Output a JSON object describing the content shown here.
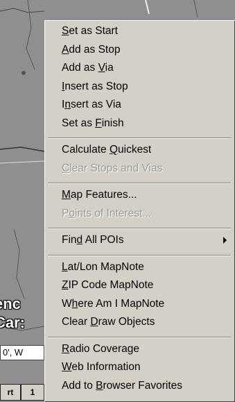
{
  "map": {
    "place_label_line1": "enc",
    "place_label_line2": "Car:",
    "coord_field_value": "0', W",
    "status_buttons": [
      "rt",
      "1"
    ]
  },
  "menu": {
    "groups": [
      [
        {
          "pre": "",
          "key": "S",
          "post": "et as Start",
          "enabled": true
        },
        {
          "pre": "",
          "key": "A",
          "post": "dd as Stop",
          "enabled": true
        },
        {
          "pre": "Add as ",
          "key": "V",
          "post": "ia",
          "enabled": true
        },
        {
          "pre": "",
          "key": "I",
          "post": "nsert as Stop",
          "enabled": true
        },
        {
          "pre": "I",
          "key": "n",
          "post": "sert as Via",
          "enabled": true
        },
        {
          "pre": "Set as ",
          "key": "F",
          "post": "inish",
          "enabled": true
        }
      ],
      [
        {
          "pre": "Calculate ",
          "key": "Q",
          "post": "uickest",
          "enabled": true
        },
        {
          "pre": "",
          "key": "C",
          "post": "lear Stops and Vias",
          "enabled": false
        }
      ],
      [
        {
          "pre": "",
          "key": "M",
          "post": "ap Features...",
          "enabled": true
        },
        {
          "pre": "P",
          "key": "o",
          "post": "ints of Interest...",
          "enabled": false
        }
      ],
      [
        {
          "pre": "Fin",
          "key": "d",
          "post": " All POIs",
          "enabled": true,
          "submenu": true
        }
      ],
      [
        {
          "pre": "",
          "key": "L",
          "post": "at/Lon MapNote",
          "enabled": true
        },
        {
          "pre": "",
          "key": "Z",
          "post": "IP Code MapNote",
          "enabled": true
        },
        {
          "pre": "W",
          "key": "h",
          "post": "ere Am I MapNote",
          "enabled": true
        },
        {
          "pre": "Clear ",
          "key": "D",
          "post": "raw Objects",
          "enabled": true
        }
      ],
      [
        {
          "pre": "",
          "key": "R",
          "post": "adio Coverage",
          "enabled": true
        },
        {
          "pre": "",
          "key": "W",
          "post": "eb Information",
          "enabled": true
        },
        {
          "pre": "Add to ",
          "key": "B",
          "post": "rowser Favorites",
          "enabled": true
        }
      ]
    ],
    "submenu_arrow_icon": "triangle-right-icon"
  }
}
